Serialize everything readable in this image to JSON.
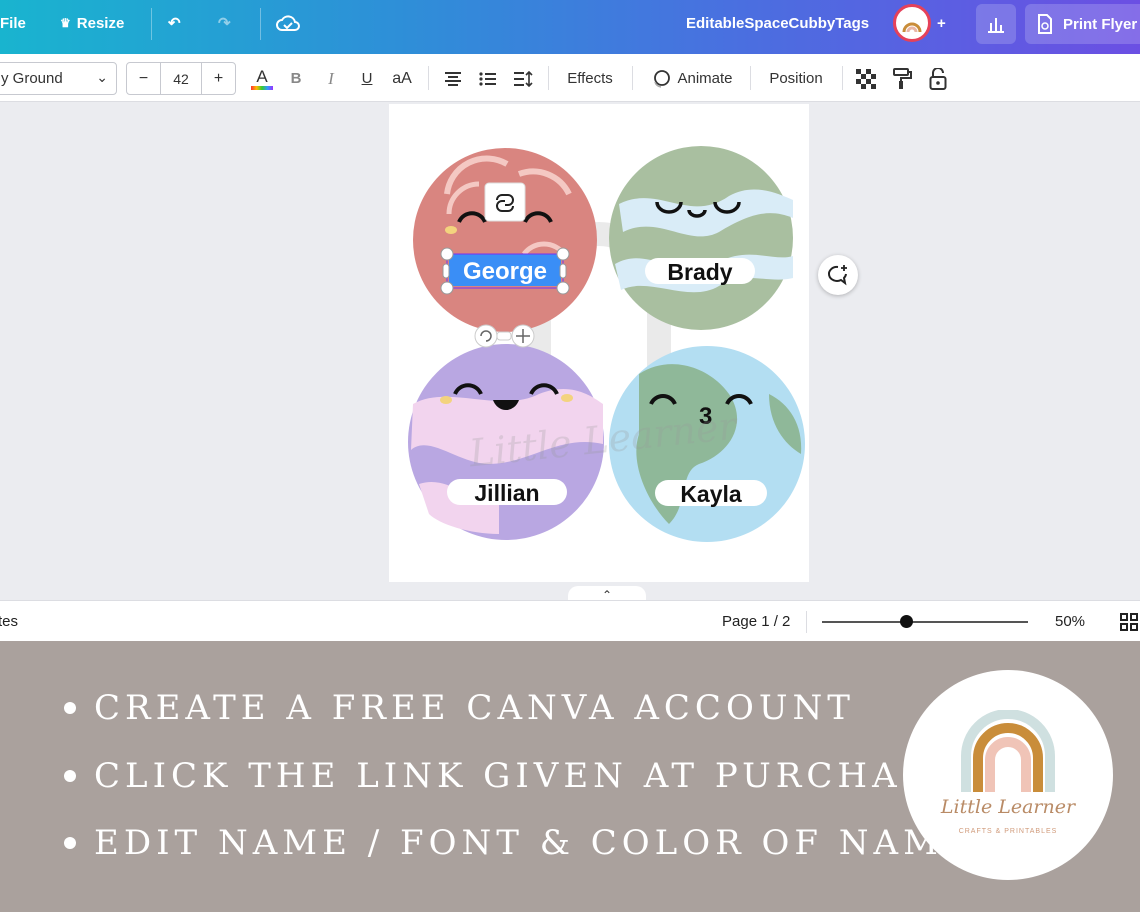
{
  "topbar": {
    "file_label": "File",
    "resize_label": "Resize",
    "design_title": "EditableSpaceCubbyTags",
    "print_label": "Print Flyer"
  },
  "toolbar": {
    "font_name": "y Ground",
    "font_size_minus": "−",
    "font_size": "42",
    "font_size_plus": "+",
    "text_color_label": "A",
    "bold_label": "B",
    "italic_label": "I",
    "underline_label": "U",
    "case_label": "aA",
    "effects_label": "Effects",
    "animate_label": "Animate",
    "position_label": "Position"
  },
  "canvas": {
    "tags": [
      {
        "name": "George",
        "bg": "#d98580"
      },
      {
        "name": "Brady",
        "bg": "#a9bfa0"
      },
      {
        "name": "Jillian",
        "bg": "#b9a7e2"
      },
      {
        "name": "Kayla",
        "bg": "#b3def2"
      }
    ],
    "watermark_text": "Little Learner"
  },
  "statusbar": {
    "notes_label": "tes",
    "page_label": "Page 1 / 2",
    "zoom_value": 0.5,
    "zoom_label": "50%"
  },
  "banner": {
    "instructions": [
      "CREATE A FREE CANVA ACCOUNT",
      "CLICK THE LINK GIVEN AT PURCHASE",
      "EDIT NAME / FONT & COLOR OF NAME"
    ],
    "logo_name": "Little Learner",
    "logo_sub": "CRAFTS & PRINTABLES"
  },
  "colors": {
    "accent": "#4a6fe0",
    "selection": "#3a8ef6",
    "banner_bg": "#aaa19d"
  }
}
